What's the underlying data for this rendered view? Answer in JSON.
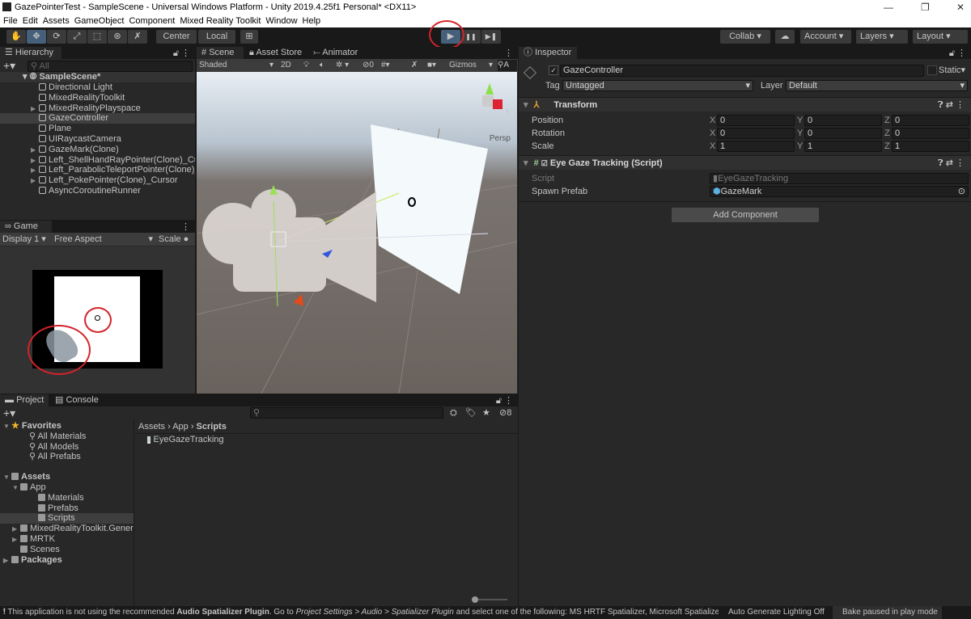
{
  "window": {
    "title": "GazePointerTest - SampleScene - Universal Windows Platform - Unity 2019.4.25f1 Personal* <DX11>"
  },
  "menu": [
    "File",
    "Edit",
    "Assets",
    "GameObject",
    "Component",
    "Mixed Reality Toolkit",
    "Window",
    "Help"
  ],
  "toolbar": {
    "tools": [
      "hand-icon",
      "move-icon",
      "rotate-icon",
      "scale-icon",
      "rect-icon",
      "transform-icon",
      "custom-tool-icon"
    ],
    "pivot": "Center",
    "space": "Local",
    "play": "▶",
    "pause": "❚❚",
    "step": "▶❚",
    "collab": "Collab",
    "account": "Account",
    "layers": "Layers",
    "layout": "Layout"
  },
  "hierarchy": {
    "tab": "Hierarchy",
    "search_placeholder": "All",
    "scene": "SampleScene*",
    "items": [
      {
        "label": "Directional Light",
        "expandable": false
      },
      {
        "label": "MixedRealityToolkit",
        "expandable": false
      },
      {
        "label": "MixedRealityPlayspace",
        "expandable": true
      },
      {
        "label": "GazeController",
        "expandable": false,
        "selected": true
      },
      {
        "label": "Plane",
        "expandable": false
      },
      {
        "label": "UIRaycastCamera",
        "expandable": false
      },
      {
        "label": "GazeMark(Clone)",
        "expandable": true
      },
      {
        "label": "Left_ShellHandRayPointer(Clone)_Cursor",
        "expandable": true
      },
      {
        "label": "Left_ParabolicTeleportPointer(Clone)_Cursor",
        "expandable": true
      },
      {
        "label": "Left_PokePointer(Clone)_Cursor",
        "expandable": true
      },
      {
        "label": "AsyncCoroutineRunner",
        "expandable": false
      }
    ]
  },
  "scene": {
    "tabs": [
      "Scene",
      "Asset Store",
      "Animator"
    ],
    "shading": "Shaded",
    "mode2d": "2D",
    "hidden_count": "0",
    "gizmos": "Gizmos",
    "search_placeholder": "A",
    "persp": "Persp",
    "gizmo_axis": "x"
  },
  "game": {
    "tab": "Game",
    "display": "Display 1",
    "aspect": "Free Aspect",
    "scale": "Scale"
  },
  "inspector": {
    "tab": "Inspector",
    "object_name": "GazeController",
    "active": true,
    "static": "Static",
    "tag_label": "Tag",
    "tag": "Untagged",
    "layer_label": "Layer",
    "layer": "Default",
    "transform": {
      "title": "Transform",
      "rows": [
        {
          "label": "Position",
          "x": "0",
          "y": "0",
          "z": "0"
        },
        {
          "label": "Rotation",
          "x": "0",
          "y": "0",
          "z": "0"
        },
        {
          "label": "Scale",
          "x": "1",
          "y": "1",
          "z": "1"
        }
      ]
    },
    "script": {
      "title": "Eye Gaze Tracking (Script)",
      "script_label": "Script",
      "script_value": "EyeGazeTracking",
      "prefab_label": "Spawn Prefab",
      "prefab_value": "GazeMark"
    },
    "add_component": "Add Component"
  },
  "project": {
    "tabs": [
      "Project",
      "Console"
    ],
    "hidden_count": "8",
    "breadcrumb": [
      "Assets",
      "App",
      "Scripts"
    ],
    "files": [
      "EyeGazeTracking"
    ],
    "tree": [
      {
        "label": "Favorites",
        "bold": true,
        "indent": 0,
        "icon": "star"
      },
      {
        "label": "All Materials",
        "indent": 2,
        "icon": "search"
      },
      {
        "label": "All Models",
        "indent": 2,
        "icon": "search"
      },
      {
        "label": "All Prefabs",
        "indent": 2,
        "icon": "search"
      },
      {
        "label": "Assets",
        "bold": true,
        "indent": 0,
        "icon": "folder"
      },
      {
        "label": "App",
        "indent": 1,
        "icon": "folder"
      },
      {
        "label": "Materials",
        "indent": 3,
        "icon": "folder"
      },
      {
        "label": "Prefabs",
        "indent": 3,
        "icon": "folder"
      },
      {
        "label": "Scripts",
        "indent": 3,
        "icon": "folder",
        "selected": true
      },
      {
        "label": "MixedRealityToolkit.Generated",
        "indent": 1,
        "icon": "folder"
      },
      {
        "label": "MRTK",
        "indent": 1,
        "icon": "folder"
      },
      {
        "label": "Scenes",
        "indent": 1,
        "icon": "folder"
      },
      {
        "label": "Packages",
        "bold": true,
        "indent": 0,
        "icon": "folder"
      }
    ]
  },
  "status": {
    "msg_pre": "This application is not using the recommended ",
    "msg_bold": "Audio Spatializer Plugin",
    "msg_mid": ". Go to ",
    "msg_ital": "Project Settings > Audio > Spatializer Plugin",
    "msg_post": " and select one of the following: MS HRTF Spatializer, Microsoft Spatializer",
    "lighting": "Auto Generate Lighting Off",
    "bake": "Bake paused in play mode"
  },
  "colors": {
    "accent": "#46607c",
    "annotation": "#d3232a",
    "selection": "#3e3e3e"
  }
}
